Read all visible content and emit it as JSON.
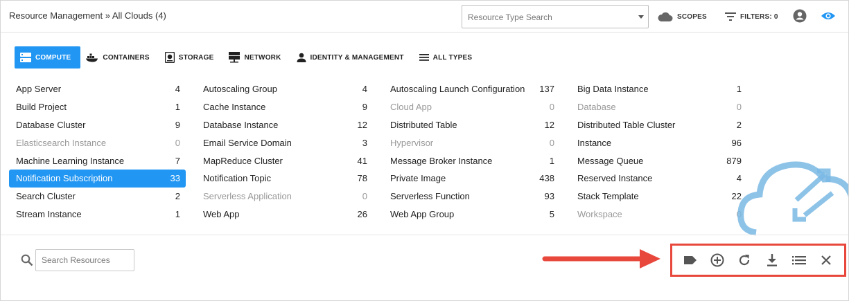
{
  "header": {
    "breadcrumb": "Resource Management » All Clouds (4)",
    "type_search_placeholder": "Resource Type Search",
    "scopes_label": "SCOPES",
    "filters_label": "FILTERS: 0",
    "icons": [
      "cloud-icon",
      "filter-icon",
      "user-icon",
      "eye-icon"
    ]
  },
  "tabs": [
    {
      "label": "COMPUTE",
      "icon": "server-icon",
      "active": true
    },
    {
      "label": "CONTAINERS",
      "icon": "docker-icon",
      "active": false
    },
    {
      "label": "STORAGE",
      "icon": "storage-icon",
      "active": false
    },
    {
      "label": "NETWORK",
      "icon": "network-icon",
      "active": false
    },
    {
      "label": "IDENTITY & MANAGEMENT",
      "icon": "person-icon",
      "active": false
    },
    {
      "label": "ALL TYPES",
      "icon": "list-icon",
      "active": false
    }
  ],
  "resources": [
    [
      {
        "name": "App Server",
        "count": "4"
      },
      {
        "name": "Build Project",
        "count": "1"
      },
      {
        "name": "Database Cluster",
        "count": "9"
      },
      {
        "name": "Elasticsearch Instance",
        "count": "0",
        "dim": true
      },
      {
        "name": "Machine Learning Instance",
        "count": "7"
      },
      {
        "name": "Notification Subscription",
        "count": "33",
        "selected": true
      },
      {
        "name": "Search Cluster",
        "count": "2"
      },
      {
        "name": "Stream Instance",
        "count": "1"
      }
    ],
    [
      {
        "name": "Autoscaling Group",
        "count": "4"
      },
      {
        "name": "Cache Instance",
        "count": "9"
      },
      {
        "name": "Database Instance",
        "count": "12"
      },
      {
        "name": "Email Service Domain",
        "count": "3"
      },
      {
        "name": "MapReduce Cluster",
        "count": "41"
      },
      {
        "name": "Notification Topic",
        "count": "78"
      },
      {
        "name": "Serverless Application",
        "count": "0",
        "dim": true
      },
      {
        "name": "Web App",
        "count": "26"
      }
    ],
    [
      {
        "name": "Autoscaling Launch Configuration",
        "count": "137"
      },
      {
        "name": "Cloud App",
        "count": "0",
        "dim": true
      },
      {
        "name": "Distributed Table",
        "count": "12"
      },
      {
        "name": "Hypervisor",
        "count": "0",
        "dim": true
      },
      {
        "name": "Message Broker Instance",
        "count": "1"
      },
      {
        "name": "Private Image",
        "count": "438"
      },
      {
        "name": "Serverless Function",
        "count": "93"
      },
      {
        "name": "Web App Group",
        "count": "5"
      }
    ],
    [
      {
        "name": "Big Data Instance",
        "count": "1"
      },
      {
        "name": "Database",
        "count": "0",
        "dim": true
      },
      {
        "name": "Distributed Table Cluster",
        "count": "2"
      },
      {
        "name": "Instance",
        "count": "96"
      },
      {
        "name": "Message Queue",
        "count": "879"
      },
      {
        "name": "Reserved Instance",
        "count": "4"
      },
      {
        "name": "Stack Template",
        "count": "22"
      },
      {
        "name": "Workspace",
        "count": "0",
        "dim": true
      }
    ]
  ],
  "search": {
    "placeholder": "Search Resources"
  },
  "toolbar": {
    "buttons": [
      "tag-icon",
      "add-circle-icon",
      "refresh-icon",
      "download-icon",
      "list-view-icon",
      "close-icon"
    ]
  },
  "colors": {
    "accent": "#2196f3",
    "highlight_border": "#e8473c",
    "dim_text": "#999999"
  }
}
